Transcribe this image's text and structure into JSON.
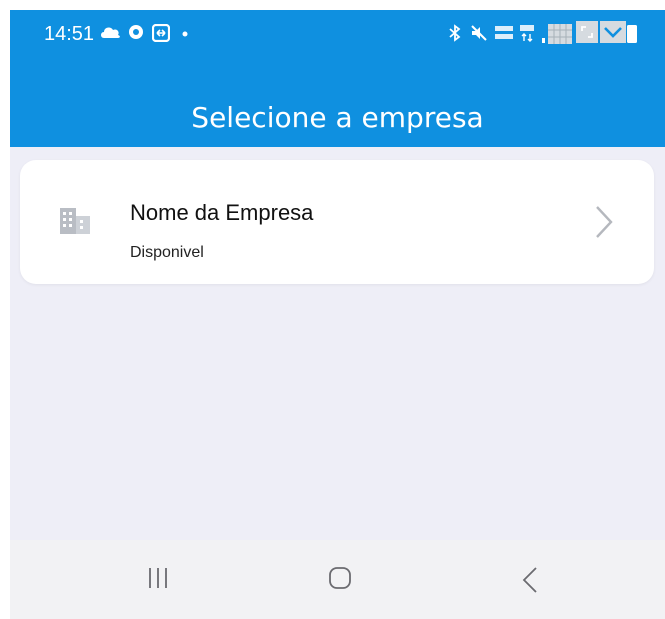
{
  "status_bar": {
    "time": "14:51",
    "left_icons": [
      "cloud-icon",
      "eye-icon",
      "app-icon",
      "dot-icon"
    ],
    "right_icons": [
      "bluetooth-icon",
      "mute-icon",
      "volte-icon",
      "4g-icon",
      "signal-icon",
      "battery-icon"
    ]
  },
  "app_bar": {
    "title": "Selecione a empresa",
    "color": "#0f90e0"
  },
  "company_list": [
    {
      "icon": "building-icon",
      "name": "Nome da Empresa",
      "status": "Disponivel",
      "action_icon": "chevron-right-icon"
    }
  ],
  "nav_bar": {
    "buttons": [
      "recent-apps-icon",
      "home-icon",
      "back-icon"
    ]
  },
  "colors": {
    "primary": "#0f90e0",
    "background": "#eeeef7",
    "card": "#ffffff"
  }
}
